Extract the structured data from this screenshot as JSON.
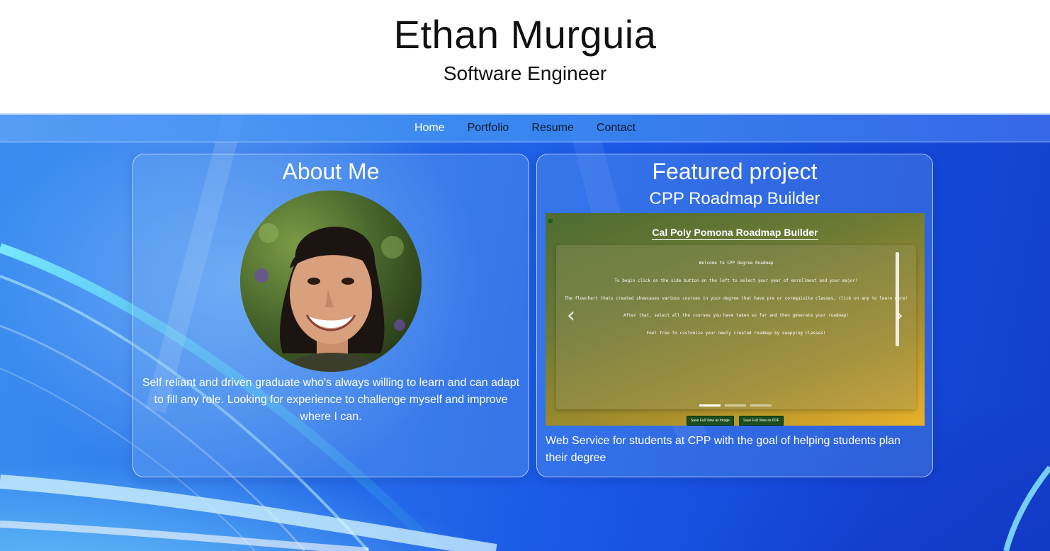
{
  "header": {
    "name": "Ethan Murguia",
    "subtitle": "Software Engineer"
  },
  "nav": {
    "items": [
      {
        "label": "Home",
        "active": true
      },
      {
        "label": "Portfolio",
        "active": false
      },
      {
        "label": "Resume",
        "active": false
      },
      {
        "label": "Contact",
        "active": false
      }
    ]
  },
  "about": {
    "title": "About Me",
    "text": "Self reliant and driven graduate who's always willing to learn and can adapt to fill any role. Looking for experience to challenge myself and improve where I can."
  },
  "featured": {
    "title": "Featured project",
    "project_name": "CPP Roadmap Builder",
    "description": "Web Service for students at CPP with the goal of helping students plan their degree",
    "screenshot": {
      "title": "Cal Poly Pomona Roadmap Builder",
      "lines": [
        "Welcome to CPP Degree Roadmap",
        "To begin click on the side button on the left to select your year of enrollment and your major!",
        "The flowchart thats created showcases various courses in your degree that have pre or corequisite classes, click on any to learn more!",
        "After that, select all the courses you have taken so far and then generate your roadmap!",
        "Feel free to customize your newly created roadmap by swapping classes!"
      ],
      "buttons": [
        "Save Full View as Image",
        "Save Full View as PDF"
      ],
      "slide_count": 3,
      "active_slide": 1
    }
  },
  "colors": {
    "header_bg": "#ffffff",
    "nav_text": "#0d1a2e",
    "nav_active": "#ffffff",
    "card_text": "#ffffff"
  }
}
